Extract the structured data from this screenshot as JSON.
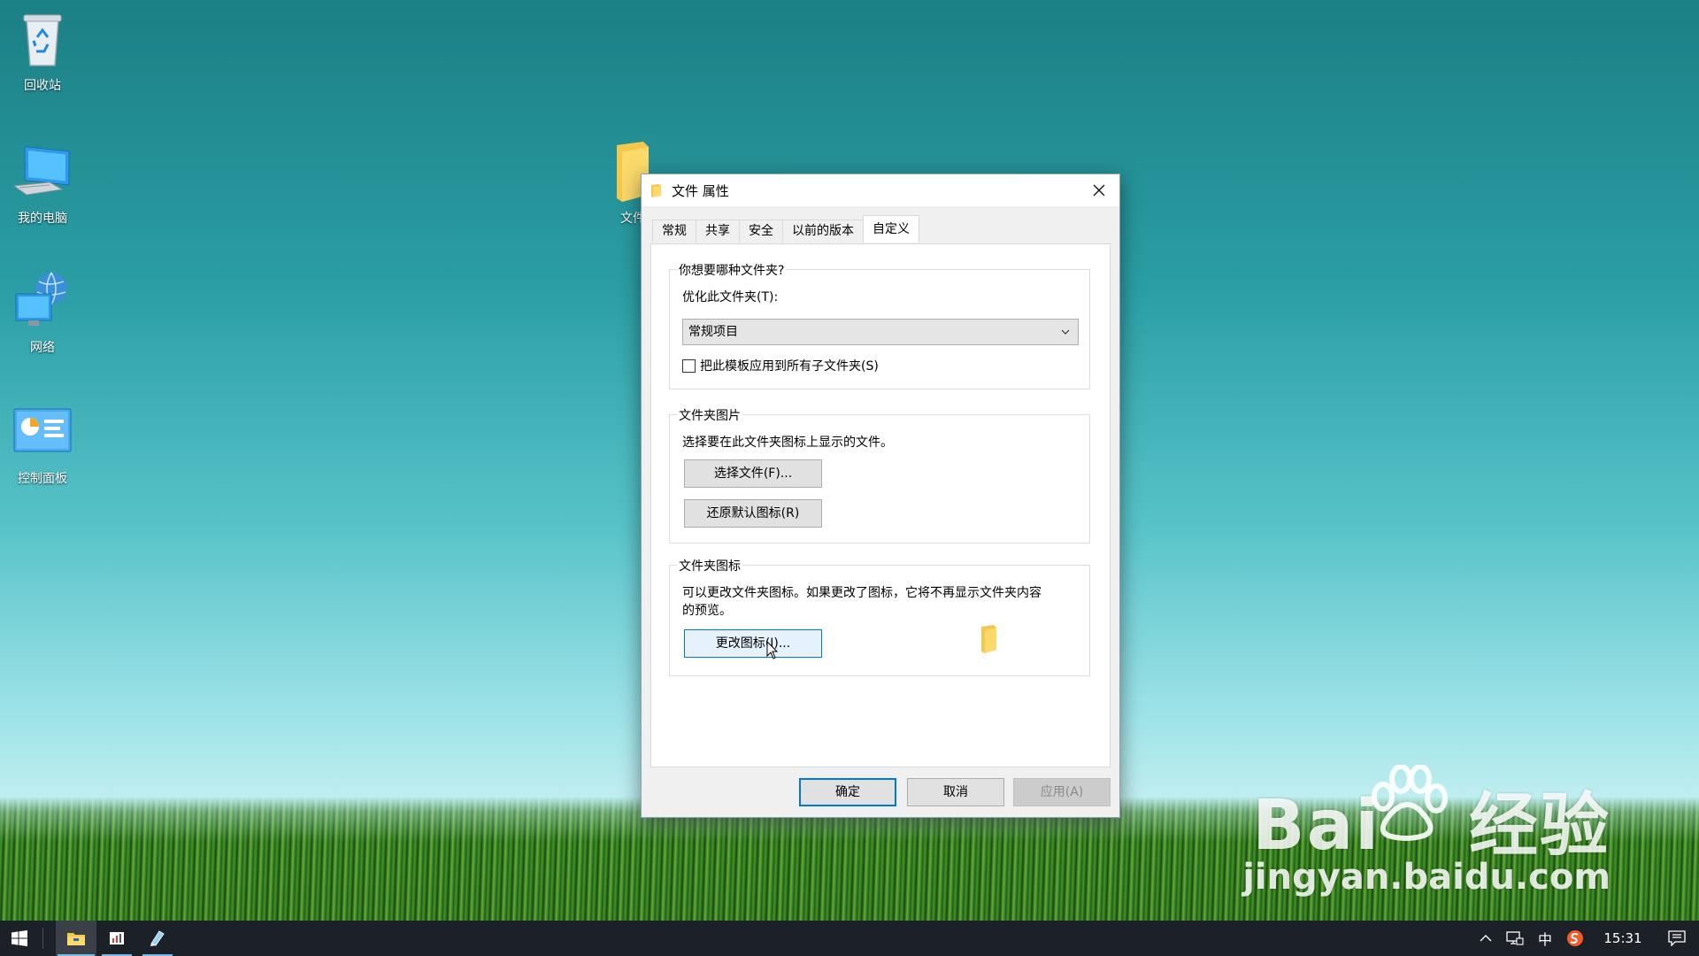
{
  "desktop": {
    "icons": [
      {
        "label": "回收站",
        "icon": "recycle-bin-icon"
      },
      {
        "label": "我的电脑",
        "icon": "computer-icon"
      },
      {
        "label": "网络",
        "icon": "network-icon"
      },
      {
        "label": "控制面板",
        "icon": "control-panel-icon"
      }
    ],
    "folder_label": "文件"
  },
  "dialog": {
    "title": "文件 属性",
    "tabs": [
      "常规",
      "共享",
      "安全",
      "以前的版本",
      "自定义"
    ],
    "active_tab": "自定义",
    "group1": {
      "legend": "你想要哪种文件夹?",
      "optimize_label": "优化此文件夹(T):",
      "optimize_value": "常规项目",
      "apply_template_label": "把此模板应用到所有子文件夹(S)",
      "apply_template_checked": false
    },
    "group2": {
      "legend": "文件夹图片",
      "description": "选择要在此文件夹图标上显示的文件。",
      "choose_file_button": "选择文件(F)...",
      "restore_default_button": "还原默认图标(R)"
    },
    "group3": {
      "legend": "文件夹图标",
      "description_line1": "可以更改文件夹图标。如果更改了图标，它将不再显示文件夹内容",
      "description_line2": "的预览。",
      "change_icon_button": "更改图标(I)..."
    },
    "buttons": {
      "ok": "确定",
      "cancel": "取消",
      "apply": "应用(A)"
    }
  },
  "taskbar": {
    "input_method": "中",
    "clock": "15:31"
  },
  "watermark": {
    "brand": "Bai",
    "brand_cn": "经验",
    "url": "jingyan.baidu.com"
  },
  "colors": {
    "accent": "#0078d7",
    "taskbar": "#1c2127",
    "folder": "#f5c84c"
  }
}
